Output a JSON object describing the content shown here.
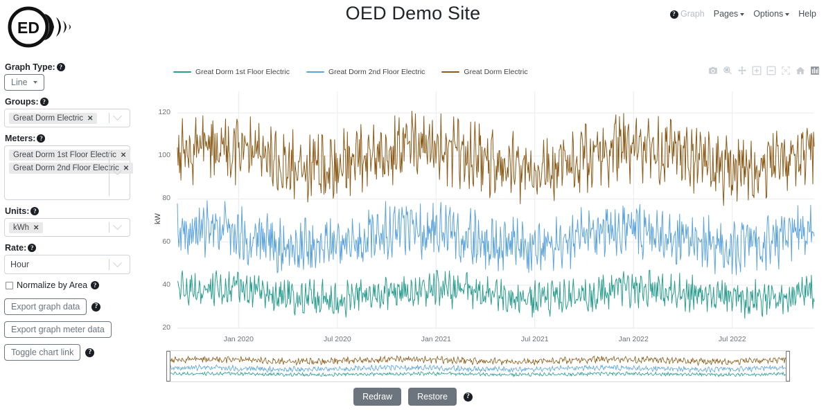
{
  "header": {
    "title": "OED Demo Site",
    "logo_text": "ED",
    "nav": [
      {
        "label": "Graph",
        "icon": "help-circle-icon",
        "state": "active-disabled",
        "caret": false
      },
      {
        "label": "Pages",
        "caret": true
      },
      {
        "label": "Options",
        "caret": true
      },
      {
        "label": "Help",
        "caret": false
      }
    ]
  },
  "sidebar": {
    "graph_type": {
      "label": "Graph Type:",
      "value": "Line",
      "help": true
    },
    "groups": {
      "label": "Groups:",
      "help": true,
      "tags": [
        "Great Dorm Electric"
      ]
    },
    "meters": {
      "label": "Meters:",
      "help": true,
      "tags": [
        "Great Dorm 1st Floor Electric",
        "Great Dorm 2nd Floor Electric"
      ]
    },
    "units": {
      "label": "Units:",
      "help": true,
      "tags": [
        "kWh"
      ]
    },
    "rate": {
      "label": "Rate:",
      "help": true,
      "value": "Hour"
    },
    "normalize": {
      "label": "Normalize by Area",
      "checked": false,
      "help": true
    },
    "buttons": [
      {
        "label": "Export graph data",
        "help": true
      },
      {
        "label": "Export graph meter data",
        "help": false
      },
      {
        "label": "Toggle chart link",
        "help": true
      }
    ]
  },
  "modebar": [
    {
      "name": "download-plot-icon",
      "title": "Download plot as a png"
    },
    {
      "name": "zoom-icon",
      "title": "Zoom"
    },
    {
      "name": "pan-icon",
      "title": "Pan"
    },
    {
      "name": "zoom-in-icon",
      "title": "Zoom in"
    },
    {
      "name": "zoom-out-icon",
      "title": "Zoom out"
    },
    {
      "name": "autoscale-icon",
      "title": "Autoscale"
    },
    {
      "name": "reset-axes-home-icon",
      "title": "Reset axes"
    },
    {
      "name": "toggle-spike-lines-icon",
      "title": "Toggle Spike Lines"
    }
  ],
  "footer": {
    "redraw_label": "Redraw",
    "restore_label": "Restore",
    "help": true
  },
  "chart_data": {
    "type": "line",
    "title": "",
    "xlabel": "",
    "ylabel": "kW",
    "ylim": [
      20,
      130
    ],
    "yticks": [
      20,
      40,
      60,
      80,
      100,
      120
    ],
    "xticks": [
      "Jan 2020",
      "Jul 2020",
      "Jan 2021",
      "Jul 2021",
      "Jan 2022",
      "Jul 2022"
    ],
    "xlim": [
      "Oct 2019",
      "Oct 2022"
    ],
    "grid": true,
    "legend_position": "top-left",
    "has_rangeslider": true,
    "series": [
      {
        "name": "Great Dorm 1st Floor Electric",
        "color": "#2a9d8f",
        "mean": 36,
        "min": 24,
        "max": 49,
        "noise": 5.5,
        "seasonal_amp": 2.5,
        "seasonal_phase": 0.4
      },
      {
        "name": "Great Dorm 2nd Floor Electric",
        "color": "#5ba3dd",
        "mean": 62,
        "min": 44,
        "max": 82,
        "noise": 8.5,
        "seasonal_amp": 4,
        "seasonal_phase": 0.9
      },
      {
        "name": "Great Dorm Electric",
        "color": "#8b5a17",
        "mean": 99,
        "min": 73,
        "max": 128,
        "noise": 10.5,
        "seasonal_amp": 5,
        "seasonal_phase": 0.6
      }
    ]
  }
}
